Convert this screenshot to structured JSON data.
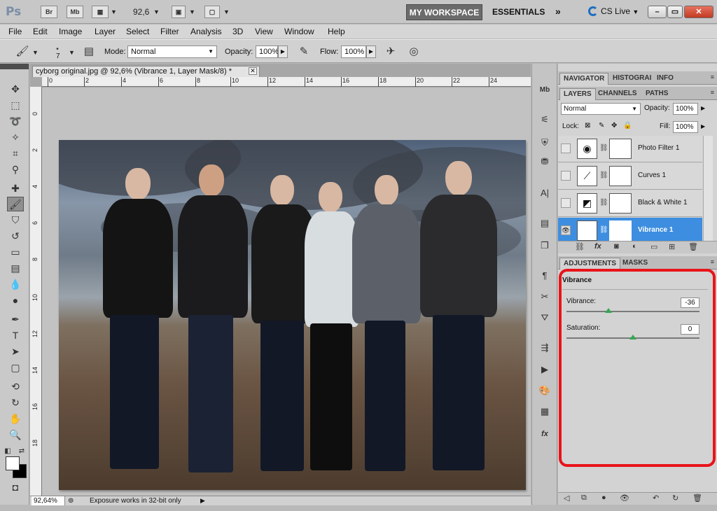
{
  "app": {
    "logo": "Ps",
    "bridge": "Br",
    "minibridge": "Mb",
    "zoom_level": "92,6",
    "workspace_active": "MY WORKSPACE",
    "workspace_essentials": "ESSENTIALS",
    "more": "»",
    "cs_live": "CS Live",
    "window_buttons": {
      "minimize": "–",
      "restore": "▭",
      "close": "✕"
    }
  },
  "menu": [
    "File",
    "Edit",
    "Image",
    "Layer",
    "Select",
    "Filter",
    "Analysis",
    "3D",
    "View",
    "Window",
    "Help"
  ],
  "options": {
    "brush_size": "7",
    "mode_label": "Mode:",
    "mode_value": "Normal",
    "opacity_label": "Opacity:",
    "opacity_value": "100%",
    "flow_label": "Flow:",
    "flow_value": "100%"
  },
  "document": {
    "tab_title": "cyborg original.jpg @ 92,6% (Vibrance 1, Layer Mask/8) *",
    "tab_close": "✕",
    "ruler_ticks": [
      "0",
      "2",
      "4",
      "6",
      "8",
      "10",
      "12",
      "14",
      "16",
      "18",
      "20",
      "22",
      "24"
    ],
    "ruler_left_ticks": [
      "0",
      "2",
      "4",
      "6",
      "8",
      "10",
      "12",
      "14",
      "16",
      "18"
    ],
    "status_zoom": "92,64%",
    "status_message": "Exposure works in 32-bit only",
    "status_arrow": "▶"
  },
  "navigator_tabs": [
    "NAVIGATOR",
    "HISTOGRAI",
    "INFO"
  ],
  "layers_panel": {
    "tabs": [
      "LAYERS",
      "CHANNELS",
      "PATHS"
    ],
    "blend_mode": "Normal",
    "opacity_label": "Opacity:",
    "opacity_value": "100%",
    "lock_label": "Lock:",
    "fill_label": "Fill:",
    "fill_value": "100%",
    "layers": [
      {
        "name": "Photo Filter 1",
        "icon": "photo-filter-icon",
        "visible": false,
        "selected": false
      },
      {
        "name": "Curves 1",
        "icon": "curves-icon",
        "visible": false,
        "selected": false
      },
      {
        "name": "Black & White 1",
        "icon": "black-white-icon",
        "visible": false,
        "selected": false
      },
      {
        "name": "Vibrance 1",
        "icon": "vibrance-icon",
        "visible": true,
        "selected": true
      }
    ]
  },
  "adjustments_panel": {
    "tabs": [
      "ADJUSTMENTS",
      "MASKS"
    ],
    "title": "Vibrance",
    "vibrance_label": "Vibrance:",
    "vibrance_value": "-36",
    "saturation_label": "Saturation:",
    "saturation_value": "0"
  },
  "colors": {
    "accent_selected": "#3d8ee0",
    "highlight_box": "#e8141a",
    "slider_thumb": "#34a853"
  }
}
